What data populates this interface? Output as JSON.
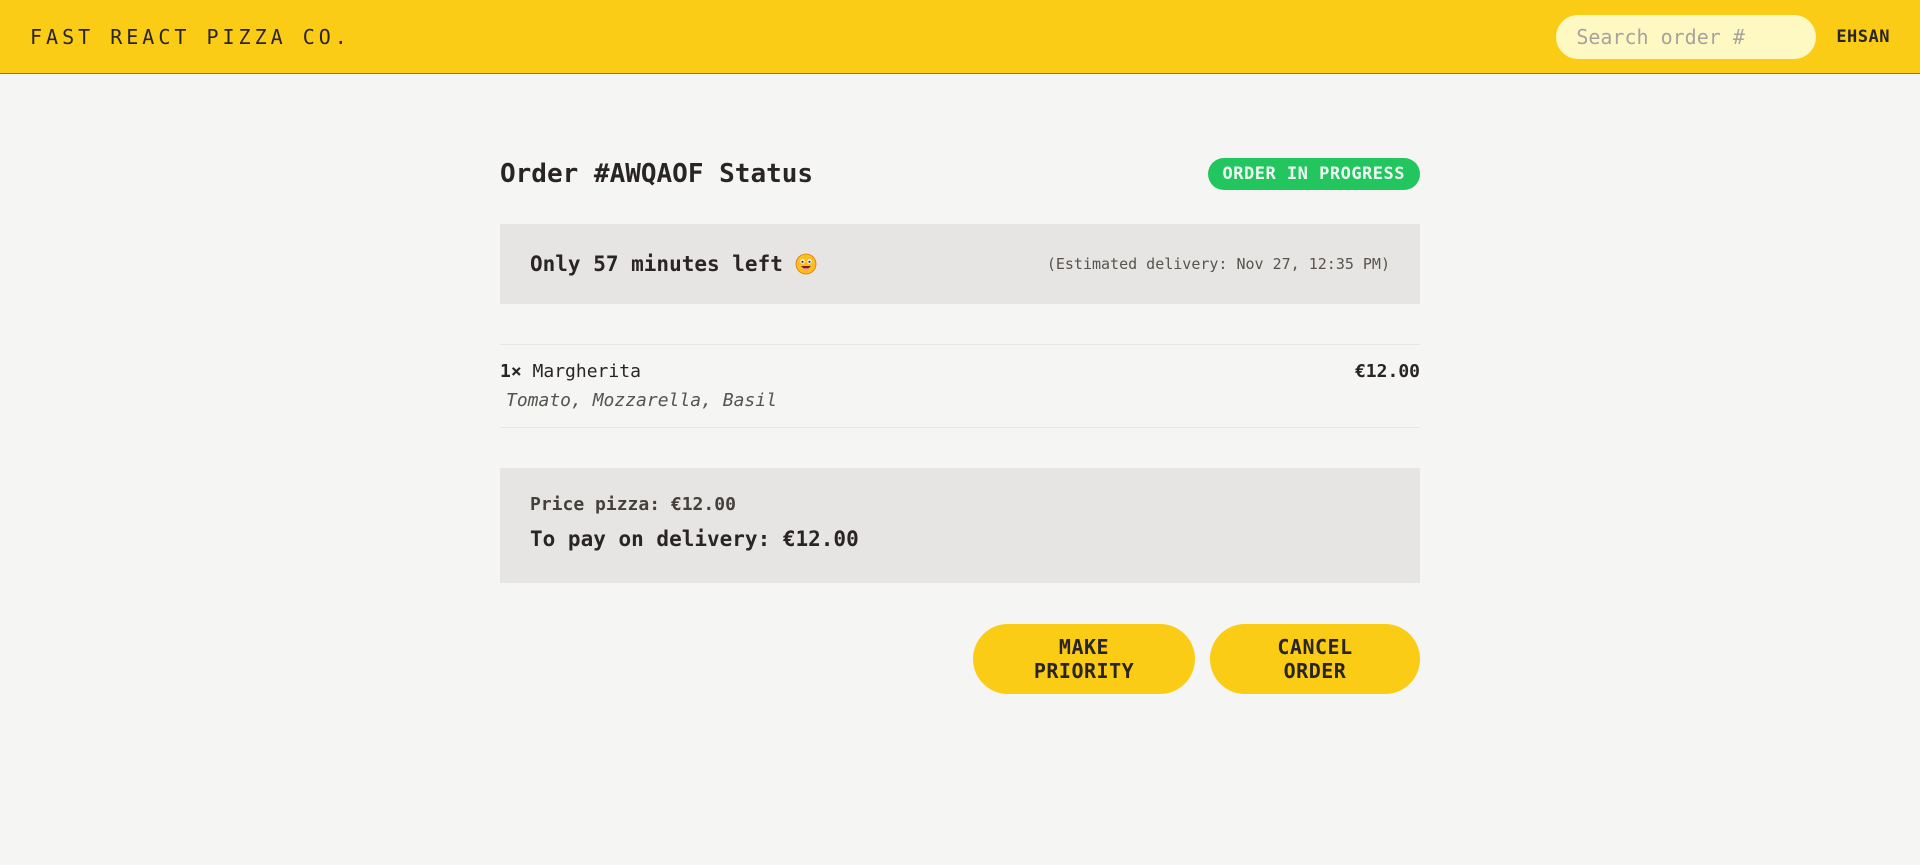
{
  "header": {
    "logo": "FAST REACT PIZZA CO.",
    "search_placeholder": "Search order #",
    "username": "EHSAN"
  },
  "order": {
    "title": "Order #AWQAOF Status",
    "status_badge": "ORDER IN PROGRESS",
    "eta_text": "Only 57 minutes left",
    "estimated_delivery": "(Estimated delivery: Nov 27, 12:35 PM)"
  },
  "items": [
    {
      "quantity": "1×",
      "name": "Margherita",
      "price": "€12.00",
      "ingredients": "Tomato, Mozzarella, Basil"
    }
  ],
  "summary": {
    "price_pizza": "Price pizza: €12.00",
    "to_pay": "To pay on delivery: €12.00"
  },
  "actions": {
    "make_priority": "MAKE PRIORITY",
    "cancel_order": "CANCEL ORDER"
  },
  "colors": {
    "accent": "#facc15",
    "status_green": "#22c55e",
    "panel": "#e7e5e4",
    "background": "#f5f5f4"
  }
}
